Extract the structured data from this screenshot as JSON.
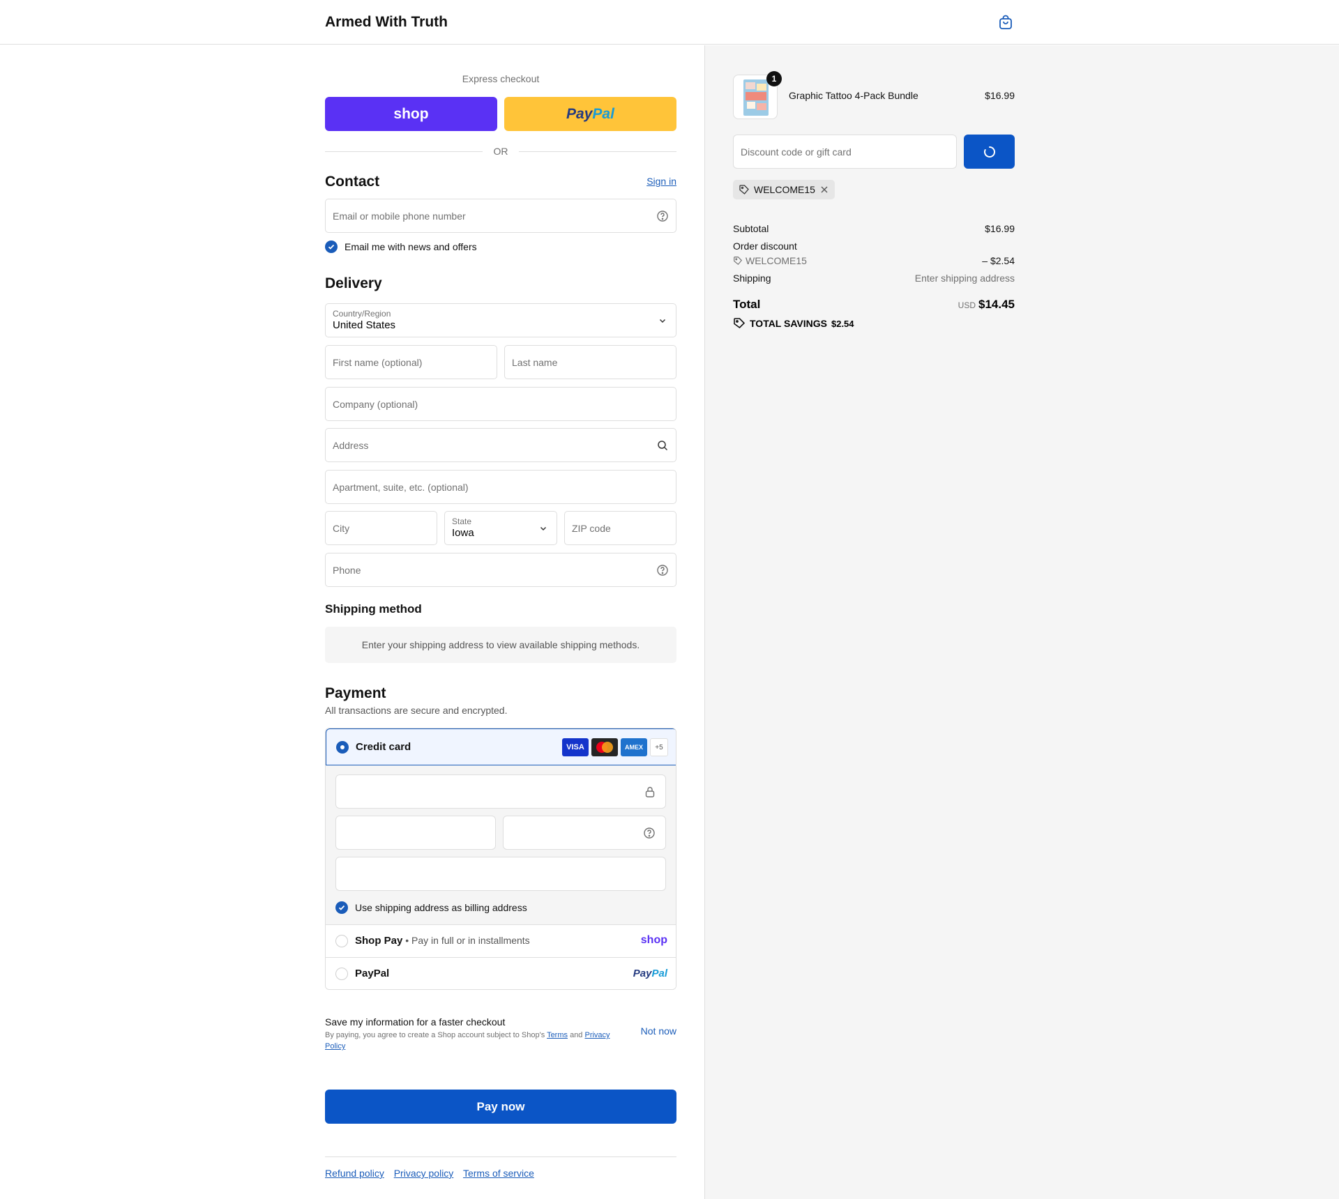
{
  "header": {
    "brand": "Armed With Truth"
  },
  "express": {
    "title": "Express checkout",
    "shop_label": "shop",
    "paypal_a": "Pay",
    "paypal_b": "Pal",
    "or_label": "OR"
  },
  "contact": {
    "heading": "Contact",
    "sign_in": "Sign in",
    "email_placeholder": "Email or mobile phone number",
    "news_label": "Email me with news and offers"
  },
  "delivery": {
    "heading": "Delivery",
    "country_label": "Country/Region",
    "country_value": "United States",
    "first_name_placeholder": "First name (optional)",
    "last_name_placeholder": "Last name",
    "company_placeholder": "Company (optional)",
    "address_placeholder": "Address",
    "apartment_placeholder": "Apartment, suite, etc. (optional)",
    "city_placeholder": "City",
    "state_label": "State",
    "state_value": "Iowa",
    "zip_placeholder": "ZIP code",
    "phone_placeholder": "Phone"
  },
  "shipping_method": {
    "heading": "Shipping method",
    "note": "Enter your shipping address to view available shipping methods."
  },
  "payment": {
    "heading": "Payment",
    "subtitle": "All transactions are secure and encrypted.",
    "credit_card_label": "Credit card",
    "card_badges": {
      "visa": "VISA",
      "amex": "AMEX",
      "more": "+5"
    },
    "billing_label": "Use shipping address as billing address",
    "shop_pay_label": "Shop Pay",
    "shop_pay_desc": "• Pay in full or in installments",
    "shop_pay_logo": "shop",
    "paypal_label": "PayPal",
    "paypal_logo_a": "Pay",
    "paypal_logo_b": "Pal"
  },
  "save_info": {
    "title": "Save my information for a faster checkout",
    "desc_prefix": "By paying, you agree to create a Shop account subject to Shop's ",
    "terms": "Terms",
    "and": " and ",
    "privacy": "Privacy Policy",
    "not_now": "Not now"
  },
  "pay_now": "Pay now",
  "footer": {
    "refund": "Refund policy",
    "privacy": "Privacy policy",
    "terms": "Terms of service"
  },
  "summary": {
    "quantity": "1",
    "product_name": "Graphic Tattoo 4-Pack Bundle",
    "product_price": "$16.99",
    "discount_placeholder": "Discount code or gift card",
    "applied_code": "WELCOME15",
    "subtotal_label": "Subtotal",
    "subtotal_value": "$16.99",
    "order_discount_label": "Order discount",
    "discount_code": "WELCOME15",
    "discount_value": "– $2.54",
    "shipping_label": "Shipping",
    "shipping_value": "Enter shipping address",
    "total_label": "Total",
    "currency": "USD",
    "total_value": "$14.45",
    "savings_label": "TOTAL SAVINGS",
    "savings_value": "$2.54"
  },
  "colors": {
    "accent": "#0b55c6",
    "shop_purple": "#5a31f4",
    "paypal_yellow": "#ffc439"
  }
}
